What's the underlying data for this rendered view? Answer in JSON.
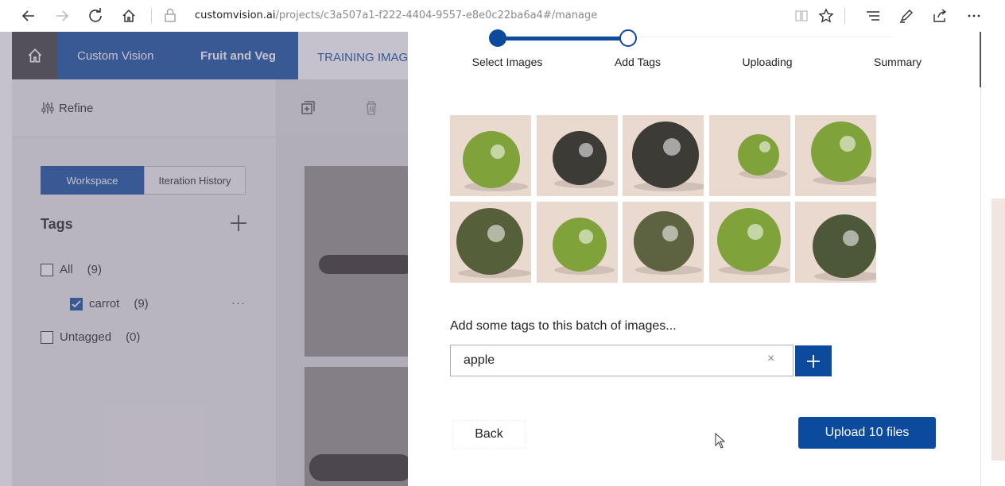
{
  "browser": {
    "url_host": "customvision.ai",
    "url_path": "/projects/c3a507a1-f222-4404-9557-e8e0c22ba6a4#/manage"
  },
  "app": {
    "nav": {
      "brand": "Custom Vision",
      "project": "Fruit and Veg",
      "tab": "TRAINING IMAGES"
    },
    "refine_label": "Refine",
    "workspace_label": "Workspace",
    "iteration_history_label": "Iteration History",
    "tags_heading": "Tags",
    "tags": [
      {
        "label": "All",
        "count": "(9)",
        "checked": false
      },
      {
        "label": "carrot",
        "count": "(9)",
        "checked": true
      },
      {
        "label": "Untagged",
        "count": "(0)",
        "checked": false
      }
    ],
    "more_label": "···"
  },
  "dialog": {
    "steps": [
      {
        "label": "Select Images",
        "state": "done"
      },
      {
        "label": "Add Tags",
        "state": "current"
      },
      {
        "label": "Uploading",
        "state": "pending"
      },
      {
        "label": "Summary",
        "state": "pending"
      }
    ],
    "image_count": 10,
    "prompt": "Add some tags to this batch of images...",
    "tag_input_value": "apple",
    "clear_label": "×",
    "back_label": "Back",
    "upload_label": "Upload 10 files"
  },
  "colors": {
    "brand_blue": "#0b4a9c",
    "apple_green": "#7fa33a",
    "apple_dark": "#3d3b36",
    "thumb_bg": "#ead9cf"
  },
  "icons": [
    "back-arrow-icon",
    "forward-arrow-icon",
    "refresh-icon",
    "home-icon",
    "lock-icon",
    "reading-view-icon",
    "favorite-star-icon",
    "hub-icon",
    "pen-icon",
    "share-icon",
    "more-icon",
    "refine-icon",
    "add-image-icon",
    "delete-icon",
    "plus-icon",
    "checkbox-icon",
    "clear-icon",
    "cursor-icon"
  ]
}
